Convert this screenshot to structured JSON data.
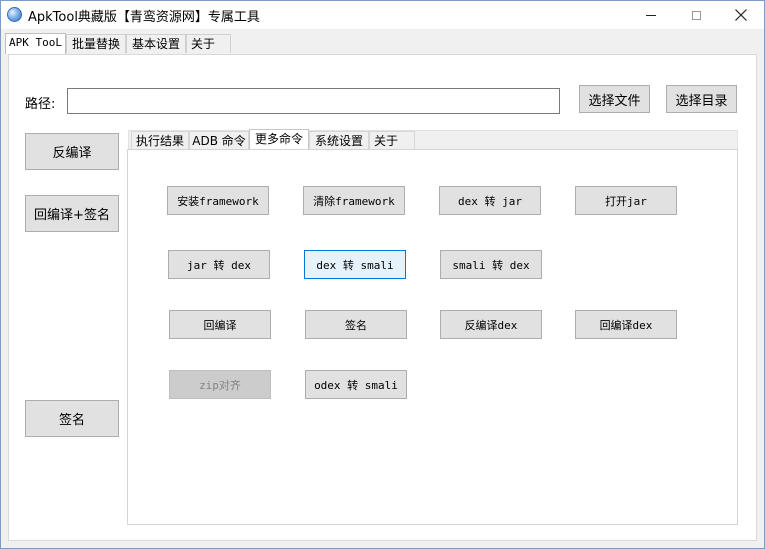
{
  "window": {
    "title": "ApkTool典藏版【青鸾资源网】专属工具"
  },
  "main_tabs": [
    {
      "label": "APK TooL"
    },
    {
      "label": "批量替换"
    },
    {
      "label": "基本设置"
    },
    {
      "label": "关于"
    }
  ],
  "path": {
    "label": "路径:",
    "value": "",
    "select_file": "选择文件",
    "select_dir": "选择目录"
  },
  "left_buttons": {
    "decompile": "反编译",
    "recompile_sign": "回编译+签名",
    "sign": "签名"
  },
  "inner_tabs": [
    {
      "label": "执行结果"
    },
    {
      "label": "ADB 命令"
    },
    {
      "label": "更多命令"
    },
    {
      "label": "系统设置"
    },
    {
      "label": "关于"
    }
  ],
  "more_commands": {
    "install_framework": "安装framework",
    "clear_framework": "清除framework",
    "dex_to_jar": "dex 转 jar",
    "open_jar": "打开jar",
    "jar_to_dex": "jar 转 dex",
    "dex_to_smali": "dex 转 smali",
    "smali_to_dex": "smali 转 dex",
    "recompile": "回编译",
    "sign": "签名",
    "decompile_dex": "反编译dex",
    "recompile_dex": "回编译dex",
    "zipalign": "zip对齐",
    "odex_to_smali": "odex 转 smali"
  }
}
